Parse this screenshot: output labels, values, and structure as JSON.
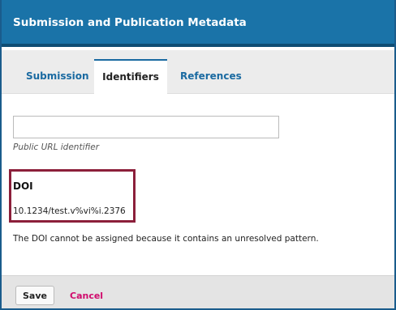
{
  "modal": {
    "title": "Submission and Publication Metadata"
  },
  "tabs": [
    {
      "label": "Submission",
      "active": false
    },
    {
      "label": "Identifiers",
      "active": true
    },
    {
      "label": "References",
      "active": false
    }
  ],
  "identifiers": {
    "public_url": {
      "value": "",
      "label": "Public URL identifier"
    },
    "doi": {
      "heading": "DOI",
      "value": "10.1234/test.v%vi%i.2376",
      "message": "The DOI cannot be assigned because it contains an unresolved pattern."
    }
  },
  "footer": {
    "save_label": "Save",
    "cancel_label": "Cancel"
  },
  "colors": {
    "header_bg": "#1a73a8",
    "tab_link": "#1a6aa1",
    "highlight_border": "#8c1f3a",
    "cancel_link": "#d00a6c"
  }
}
